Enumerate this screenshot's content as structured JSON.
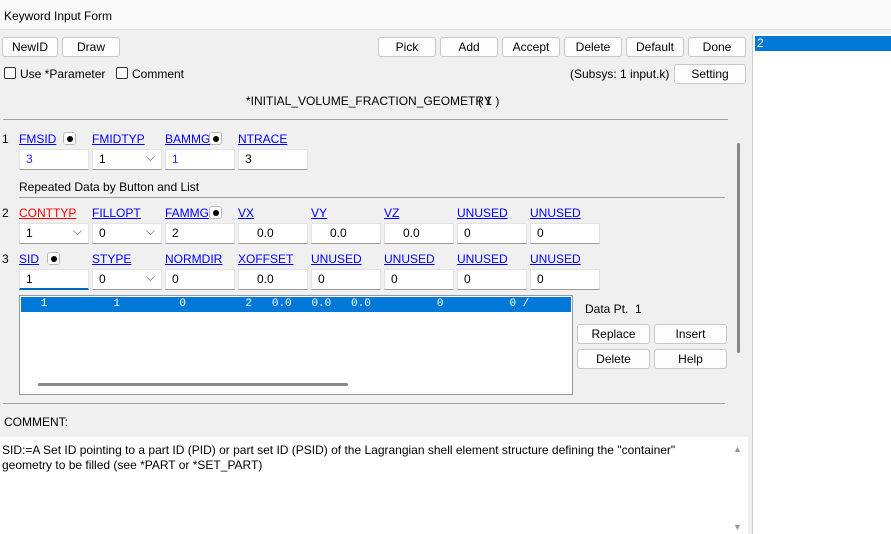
{
  "window": {
    "title": "Keyword Input Form"
  },
  "toolbar": {
    "newid": "NewID",
    "draw": "Draw",
    "pick": "Pick",
    "add": "Add",
    "accept": "Accept",
    "delete": "Delete",
    "default": "Default",
    "done": "Done"
  },
  "options": {
    "use_parameter": "Use *Parameter",
    "comment": "Comment",
    "subsys": "(Subsys: 1 input.k)",
    "setting": "Setting"
  },
  "keyword": {
    "name": "*INITIAL_VOLUME_FRACTION_GEOMETRY",
    "count": "( 1 )"
  },
  "card1": {
    "num": "1",
    "fields": [
      {
        "label": "FMSID",
        "value": "3"
      },
      {
        "label": "FMIDTYP",
        "value": "1"
      },
      {
        "label": "BAMMG",
        "value": "1"
      },
      {
        "label": "NTRACE",
        "value": "3"
      }
    ]
  },
  "repeated_label": "Repeated Data by Button and List",
  "card2": {
    "num": "2",
    "fields": [
      {
        "label": "CONTTYP",
        "value": "1"
      },
      {
        "label": "FILLOPT",
        "value": "0"
      },
      {
        "label": "FAMMG",
        "value": "2"
      },
      {
        "label": "VX",
        "value": "0.0"
      },
      {
        "label": "VY",
        "value": "0.0"
      },
      {
        "label": "VZ",
        "value": "0.0"
      },
      {
        "label": "UNUSED",
        "value": "0"
      },
      {
        "label": "UNUSED",
        "value": "0"
      }
    ]
  },
  "card3": {
    "num": "3",
    "fields": [
      {
        "label": "SID",
        "value": "1"
      },
      {
        "label": "STYPE",
        "value": "0"
      },
      {
        "label": "NORMDIR",
        "value": "0"
      },
      {
        "label": "XOFFSET",
        "value": "0.0"
      },
      {
        "label": "UNUSED",
        "value": "0"
      },
      {
        "label": "UNUSED",
        "value": "0"
      },
      {
        "label": "UNUSED",
        "value": "0"
      },
      {
        "label": "UNUSED",
        "value": "0"
      }
    ]
  },
  "list": {
    "rows": [
      "   1          1         0         2   0.0   0.0   0.0          0          0 /"
    ]
  },
  "datapt": {
    "label": "Data Pt.",
    "value": "1"
  },
  "list_buttons": {
    "replace": "Replace",
    "insert": "Insert",
    "delete": "Delete",
    "help": "Help"
  },
  "comment": {
    "label": "COMMENT:",
    "text": "SID:=A Set ID pointing to a part ID (PID) or part set ID (PSID) of the Lagrangian shell element structure defining the \"container\" geometry to be filled (see *PART or *SET_PART)"
  },
  "right_list": {
    "items": [
      "2"
    ]
  },
  "colors": {
    "selection": "#0078d7",
    "link": "#0000ff",
    "required": "#ff0000"
  }
}
